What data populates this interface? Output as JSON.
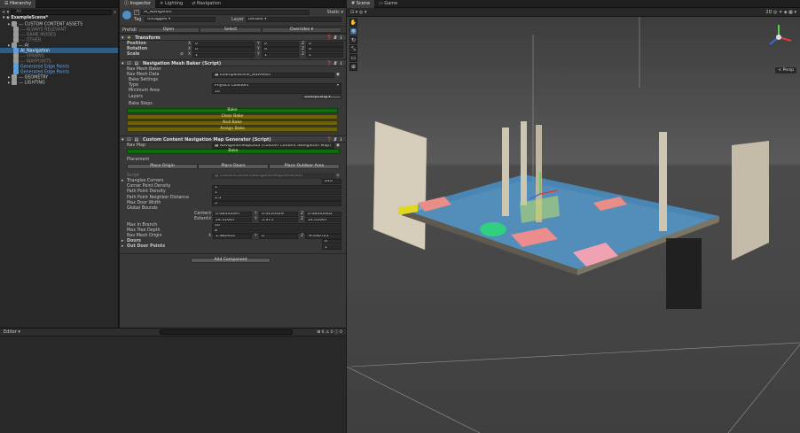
{
  "hierarchy": {
    "tab": "Hierarchy",
    "add": "+ ▾",
    "search_placeholder": "All",
    "scene": "ExampleScene*",
    "items": [
      {
        "label": "--- CUSTOM CONTENT ASSETS",
        "indent": 1,
        "faded": false
      },
      {
        "label": "--- ALWAYS RELEVANT",
        "indent": 2,
        "faded": true
      },
      {
        "label": "--- GAME MODES",
        "indent": 2,
        "faded": true
      },
      {
        "label": "--- OTHER",
        "indent": 2,
        "faded": true
      },
      {
        "label": "--- AI",
        "indent": 1,
        "faded": false
      },
      {
        "label": "AI_Navigation",
        "indent": 2,
        "faded": false,
        "selected": true
      },
      {
        "label": "--- SPAWNS",
        "indent": 2,
        "faded": true
      },
      {
        "label": "--- WAYPOINTS",
        "indent": 2,
        "faded": true
      },
      {
        "label": "Generated Edge Points",
        "indent": 2,
        "faded": false,
        "blue": true
      },
      {
        "label": "Generated Edge Points",
        "indent": 2,
        "faded": false,
        "blue": true
      },
      {
        "label": "--- GEOMETRY",
        "indent": 1,
        "faded": false
      },
      {
        "label": "--- LIGHTING",
        "indent": 1,
        "faded": false
      }
    ]
  },
  "project": {
    "tab": "Editor ▾",
    "status": "⊞ 6  ⚠ 0  ⓘ 0"
  },
  "inspector": {
    "tabs": [
      "Inspector",
      "Lighting",
      "Navigation"
    ],
    "object_name": "AI_Navigation",
    "static_label": "Static ▾",
    "tag_label": "Tag",
    "tag_value": "Untagged",
    "layer_label": "Layer",
    "layer_value": "Default",
    "prefab_label": "Prefab",
    "prefab_open": "Open",
    "prefab_select": "Select",
    "prefab_overrides": "Overrides",
    "transform": {
      "title": "Transform",
      "position": {
        "label": "Position",
        "x": "0",
        "y": "0",
        "z": "0"
      },
      "rotation": {
        "label": "Rotation",
        "x": "0",
        "y": "0",
        "z": "0"
      },
      "scale": {
        "label": "Scale",
        "x": "1",
        "y": "1",
        "z": "1"
      }
    },
    "baker": {
      "title": "Navigation Mesh Baker (Script)",
      "nav_mesh_baker": "Nav Mesh Baker",
      "nav_mesh_data_label": "Nav Mesh Data",
      "nav_mesh_data_value": "ExampleScene_NavMesh",
      "bake_settings": "Bake Settings",
      "type_label": "Type",
      "type_value": "Physics Colliders",
      "min_area_label": "Minimum Area",
      "min_area_value": "10",
      "layers_label": "Layers",
      "layers_value": "Everything",
      "bake_steps": "Bake Steps",
      "bake": "Bake",
      "clear_bake": "Clear Bake",
      "null_bake": "Null Bake",
      "assign_bake": "Assign Bake"
    },
    "generator": {
      "title": "Custom Content Navigation Map Generator (Script)",
      "nav_map_label": "Nav Map",
      "nav_map_value": "NavigationMapData (Custom Content Navigation Map)",
      "bake": "Bake",
      "placement": "Placement",
      "place_origin": "Place Origin",
      "place_doors": "Place Doors",
      "place_outdoor_area": "Place Outdoor Area",
      "script_label": "Script",
      "script_value": "CustomContentNavigationMapGenerator",
      "triangles_label": "Triangles Corners",
      "triangles_value": "240",
      "corner_density_label": "Corner Point Density",
      "corner_density_value": "1",
      "path_density_label": "Path Point Density",
      "path_density_value": "1",
      "neighbor_label": "Path Point Neighbor Distance",
      "neighbor_value": "1.5",
      "max_door_label": "Max Door Width",
      "max_door_value": "5",
      "global_bounds": "Global Bounds",
      "center_label": "Center",
      "center": {
        "x": "0.08333397",
        "y": "0.4120029",
        "z": "0.08333302"
      },
      "extent_label": "Extent",
      "extent": {
        "x": "24.41667",
        "y": "5.375",
        "z": "14.41667"
      },
      "max_branch_label": "Max In Branch",
      "max_branch_value": "10",
      "max_tree_label": "Max Tree Depth",
      "max_tree_value": "8",
      "origin_label": "Nav Mesh Origin",
      "origin": {
        "x": "1.382914",
        "y": "0",
        "z": "-9.490721"
      },
      "doors_label": "Doors",
      "doors_value": "6",
      "out_door_label": "Out Door Points",
      "out_door_value": "1",
      "add_component": "Add Component"
    }
  },
  "scene_view": {
    "tabs": [
      "Scene",
      "Game"
    ],
    "toolbar_right": "2D  ◎  ✶  ◈  ▦ ▾",
    "persp": "< Persp"
  },
  "colors": {
    "bg_dark": "#191919",
    "panel": "#383838",
    "field": "#2a2a2a",
    "selected": "#2c5d87",
    "green_bar": "#0b6e0b",
    "olive_bar": "#6e6207",
    "navmesh": "#4a9bd8"
  }
}
